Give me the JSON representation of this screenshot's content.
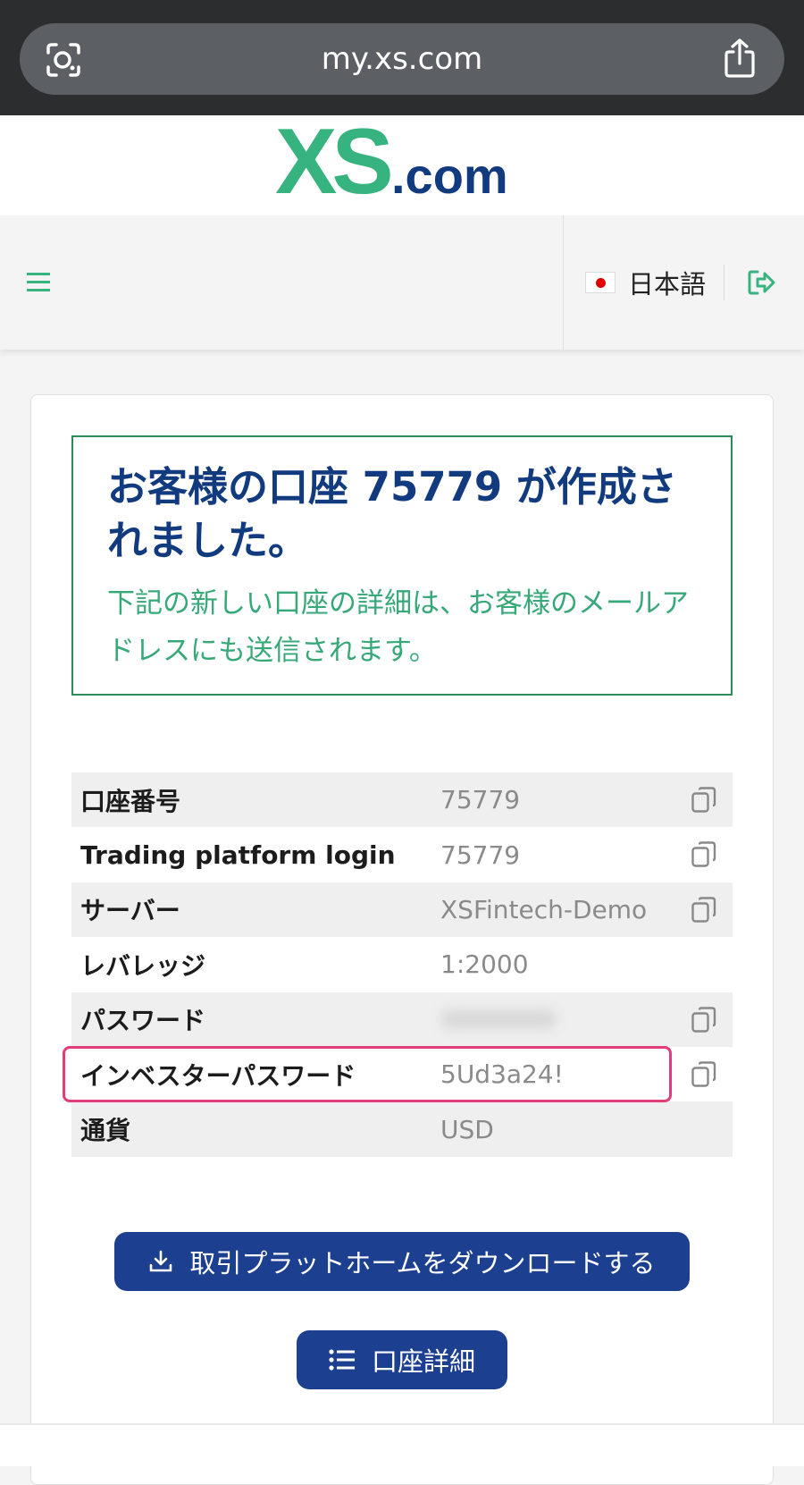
{
  "browser": {
    "url": "my.xs.com",
    "lens_icon": "screen-search-icon",
    "share_icon": "share-icon"
  },
  "brand": {
    "logo_main": "XS",
    "logo_suffix": ".com",
    "green": "#36b37e",
    "navy": "#123a7e"
  },
  "nav": {
    "menu_icon": "hamburger-icon",
    "language_label": "日本語",
    "flag_icon": "japan-flag-icon",
    "logout_icon": "logout-icon"
  },
  "notice": {
    "title": "お客様の口座 75779 が作成されました。",
    "subtitle": "下記の新しい口座の詳細は、お客様のメールアドレスにも送信されます。"
  },
  "details": {
    "rows": [
      {
        "label": "口座番号",
        "value": "75779",
        "copyable": true
      },
      {
        "label": "Trading platform login",
        "value": "75779",
        "copyable": true
      },
      {
        "label": "サーバー",
        "value": "XSFintech-Demo",
        "copyable": true
      },
      {
        "label": "レバレッジ",
        "value": "1:2000",
        "copyable": false
      },
      {
        "label": "パスワード",
        "value": "",
        "copyable": true
      },
      {
        "label": "インベスターパスワード",
        "value": "5Ud3a24!",
        "copyable": true
      },
      {
        "label": "通貨",
        "value": "USD",
        "copyable": false
      }
    ]
  },
  "actions": {
    "download_label": "取引プラットホームをダウンロードする",
    "details_label": "口座詳細"
  },
  "colors": {
    "highlight": "#e23c7a",
    "button": "#1c3f8f"
  }
}
